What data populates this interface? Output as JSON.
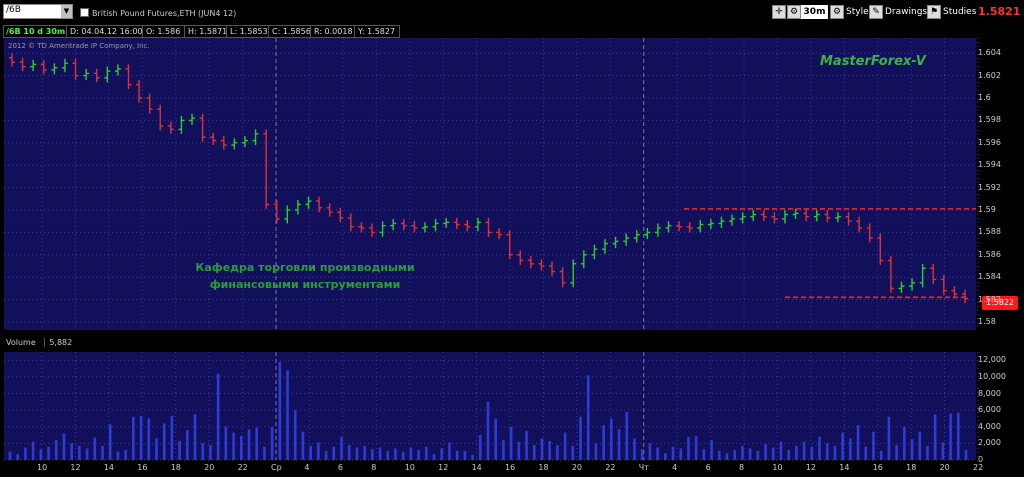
{
  "toolbar": {
    "symbol": "/6B",
    "instrument": "British Pound Futures,ETH (JUN4 12)",
    "timeframe": "30m",
    "style_label": "Style",
    "drawings_label": "Drawings",
    "studies_label": "Studies",
    "last_price": "1.5821"
  },
  "infobar": {
    "period": "/6B 10 d 30m",
    "date": "D: 04.04.12 16:00",
    "open": "O: 1.586",
    "high": "H: 1.5871",
    "low": "L: 1.5853",
    "close": "C: 1.5856",
    "range": "R: 0.0018",
    "y": "Y: 1.5827"
  },
  "copyright": "2012 © TD Ameritrade IP Company, Inc.",
  "watermark": "MasterForex-V",
  "dept_lines": [
    "Кафедра торговли производными",
    "финансовыми инструментами"
  ],
  "price_tag": "1.5822",
  "volume_label": "Volume",
  "volume_value": "5,882",
  "colors": {
    "bg": "#12105a",
    "up": "#2ecc2e",
    "down": "#e0303a",
    "volume": "#2c3cd6",
    "grid": "#3a3aa0"
  },
  "chart_data": [
    {
      "type": "candlestick",
      "title": "British Pound Futures,ETH (JUN4 12)",
      "y_ticks": [
        "1.604",
        "1.602",
        "1.6",
        "1.598",
        "1.596",
        "1.594",
        "1.592",
        "1.59",
        "1.588",
        "1.586",
        "1.584",
        "1.582",
        "1.58"
      ],
      "ylim": [
        1.58,
        1.605
      ],
      "resistance_line": 1.5901,
      "support_line": 1.5822,
      "closes": [
        1.6032,
        1.6028,
        1.603,
        1.6025,
        1.6027,
        1.6031,
        1.602,
        1.6022,
        1.6018,
        1.6024,
        1.6026,
        1.6012,
        1.6,
        1.599,
        1.5975,
        1.5972,
        1.598,
        1.5982,
        1.5965,
        1.5962,
        1.5958,
        1.596,
        1.5962,
        1.5968,
        1.5905,
        1.5892,
        1.59,
        1.5905,
        1.5908,
        1.5902,
        1.5898,
        1.5893,
        1.5885,
        1.5884,
        1.588,
        1.5886,
        1.5888,
        1.5886,
        1.5884,
        1.5885,
        1.5888,
        1.5889,
        1.5887,
        1.5885,
        1.5889,
        1.588,
        1.5878,
        1.586,
        1.5855,
        1.5852,
        1.585,
        1.5845,
        1.5835,
        1.5852,
        1.586,
        1.5865,
        1.587,
        1.5872,
        1.5875,
        1.5878,
        1.588,
        1.5884,
        1.5886,
        1.5885,
        1.5884,
        1.5887,
        1.5888,
        1.589,
        1.5892,
        1.5894,
        1.5896,
        1.5894,
        1.5892,
        1.5896,
        1.5897,
        1.5894,
        1.5896,
        1.5893,
        1.5894,
        1.589,
        1.5884,
        1.5875,
        1.5855,
        1.583,
        1.5832,
        1.5835,
        1.5848,
        1.5838,
        1.5828,
        1.5825,
        1.5821
      ]
    },
    {
      "type": "bar",
      "title": "Volume",
      "y_ticks": [
        "12,000",
        "10,000",
        "8,000",
        "6,000",
        "4,000",
        "2,000",
        "0"
      ],
      "ylim": [
        0,
        13000
      ],
      "values": [
        1000,
        700,
        1500,
        2200,
        1300,
        1600,
        2400,
        3200,
        2000,
        1700,
        1400,
        2700,
        1700,
        4300,
        1000,
        1200,
        5200,
        5300,
        5000,
        2600,
        4400,
        5300,
        2300,
        3600,
        5500,
        2000,
        1800,
        10400,
        4000,
        3300,
        2900,
        3700,
        3900,
        1600,
        4000,
        11800,
        10800,
        6000,
        3400,
        1700,
        2100,
        1100,
        1600,
        2800,
        1800,
        1500,
        1700,
        1300,
        1500,
        1100,
        1400,
        1000,
        1500,
        1200,
        1600,
        700,
        1400,
        2100,
        1100,
        1100,
        600,
        3000,
        7000,
        5000,
        2400,
        4000,
        2200,
        3500,
        1800,
        2600,
        2300,
        1800,
        3300,
        1700,
        5200,
        10200,
        2000,
        4200,
        5000,
        3700,
        5800,
        2600,
        1300,
        2000,
        1500,
        800,
        1600,
        1400,
        2800,
        2900,
        1300,
        2400,
        1100,
        800,
        1200,
        1700,
        1400,
        1100,
        1900,
        1500,
        2200,
        1200,
        1700,
        2200,
        1600,
        2800,
        2000,
        1700,
        3300,
        2600,
        4200,
        1600,
        3400,
        1100,
        5200,
        1800,
        4000,
        2500,
        3400,
        1700,
        5500,
        2100,
        5600,
        5700,
        1200
      ]
    }
  ],
  "x_labels": [
    "10",
    "12",
    "14",
    "16",
    "18",
    "20",
    "22",
    "Ср",
    "4",
    "6",
    "8",
    "10",
    "12",
    "14",
    "16",
    "18",
    "20",
    "22",
    "Чт",
    "4",
    "6",
    "8",
    "10",
    "12",
    "14",
    "16",
    "18",
    "20",
    "22"
  ]
}
